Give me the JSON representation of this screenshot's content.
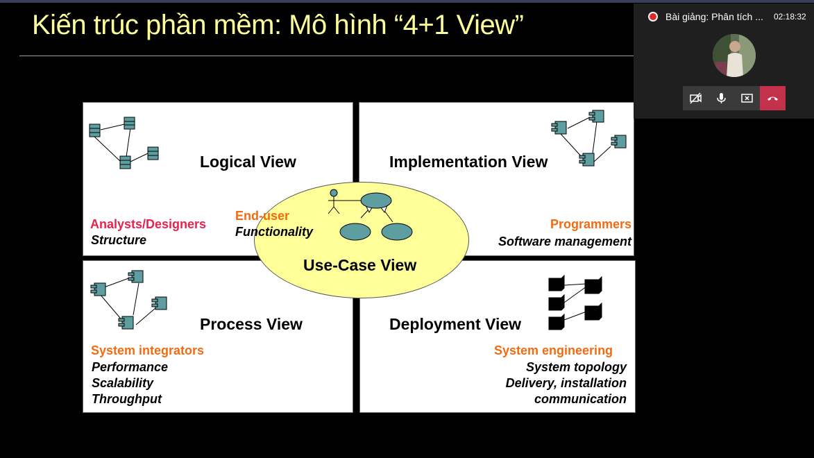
{
  "slide": {
    "title": "Kiến trúc phần mềm: Mô hình “4+1 View”"
  },
  "views": {
    "logical": {
      "title": "Logical View",
      "role": "Analysts/Designers",
      "concerns": [
        "Structure"
      ],
      "icon": "class-diagram-icon"
    },
    "implementation": {
      "title": "Implementation View",
      "role": "Programmers",
      "concerns": [
        "Software management"
      ],
      "icon": "component-diagram-icon"
    },
    "process": {
      "title": "Process View",
      "role": "System integrators",
      "concerns": [
        "Performance",
        "Scalability",
        "Throughput"
      ],
      "icon": "component-diagram-icon"
    },
    "deployment": {
      "title": "Deployment View",
      "role": "System engineering",
      "concerns": [
        "System topology",
        "Delivery, installation",
        "communication"
      ],
      "icon": "node-diagram-icon"
    },
    "usecase": {
      "title": "Use-Case View",
      "role": "End-user",
      "concerns": [
        "Functionality"
      ],
      "icon": "use-case-diagram-icon"
    }
  },
  "colors": {
    "title": "#ffff99",
    "role_red": "#e8224d",
    "role_orange": "#f26b10",
    "usecase_fill": "#ffff99",
    "uml_fill": "#5f9ea0",
    "hangup": "#c4314b"
  },
  "call": {
    "meeting_title": "Bài giảng: Phân tích ...",
    "timer": "02:18:32",
    "controls": [
      "camera-off-icon",
      "microphone-icon",
      "stop-share-icon",
      "hang-up-icon"
    ]
  }
}
